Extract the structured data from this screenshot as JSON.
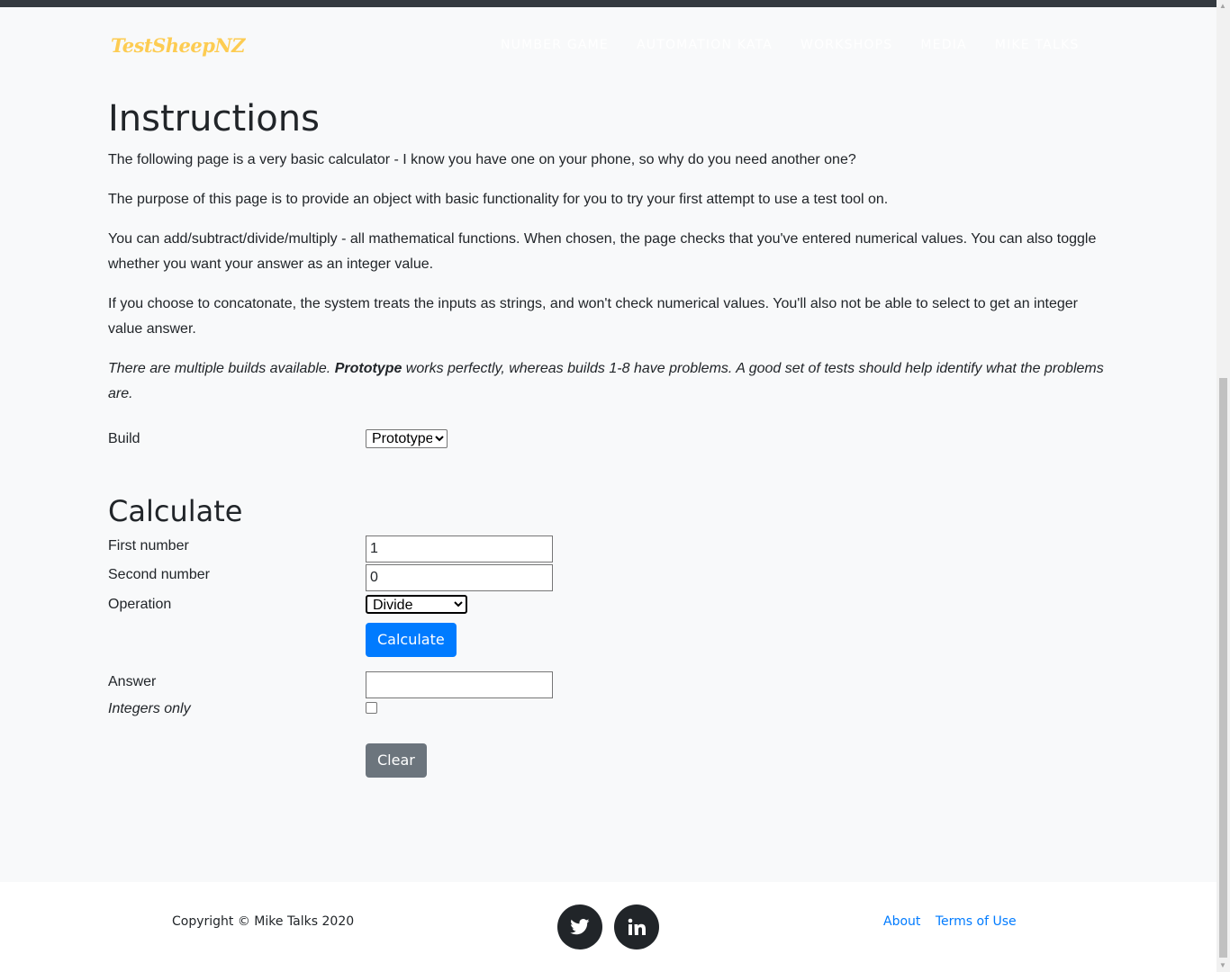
{
  "navbar": {
    "brand": "TestSheepNZ",
    "links": [
      "Number Game",
      "Automation Kata",
      "Workshops",
      "Media",
      "Mike Talks"
    ]
  },
  "instructions": {
    "title": "Instructions",
    "p1": "The following page is a very basic calculator - I know you have one on your phone, so why do you need another one?",
    "p2": "The purpose of this page is to provide an object with basic functionality for you to try your first attempt to use a test tool on.",
    "p3": "You can add/subtract/divide/multiply - all mathematical functions. When chosen, the page checks that you've entered numerical values. You can also toggle whether you want your answer as an integer value.",
    "p4": "If you choose to concatonate, the system treats the inputs as strings, and won't check numerical values. You'll also not be able to select to get an integer value answer.",
    "p5_before": "There are multiple builds available. ",
    "p5_bold": "Prototype",
    "p5_after": " works perfectly, whereas builds 1-8 have problems. A good set of tests should help identify what the problems are."
  },
  "build": {
    "label": "Build",
    "selected": "Prototype"
  },
  "calculate": {
    "title": "Calculate",
    "first_label": "First number",
    "first_value": "1",
    "second_label": "Second number",
    "second_value": "0",
    "operation_label": "Operation",
    "operation_selected": "Divide",
    "calculate_button": "Calculate",
    "answer_label": "Answer",
    "answer_value": "",
    "integers_label": "Integers only",
    "integers_checked": false,
    "clear_button": "Clear"
  },
  "footer": {
    "copyright": "Copyright © Mike Talks 2020",
    "social": [
      "twitter-icon",
      "linkedin-icon"
    ],
    "links": [
      "About",
      "Terms of Use"
    ]
  },
  "colors": {
    "brand": "#fdcc52",
    "primary": "#007bff",
    "secondary": "#6c757d",
    "topbar": "#343a40"
  }
}
